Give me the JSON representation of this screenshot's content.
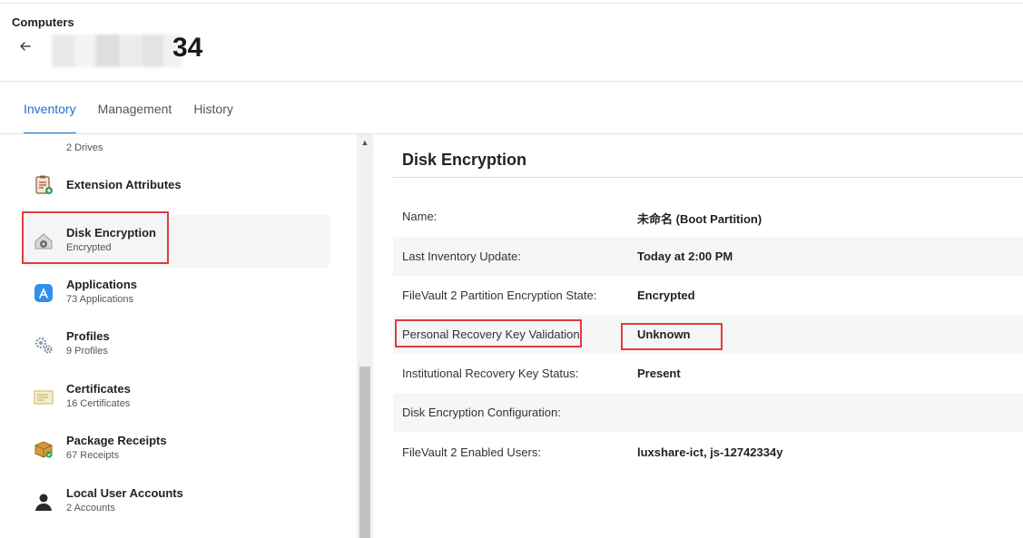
{
  "header": {
    "breadcrumb": "Computers",
    "title_visible_suffix": "34"
  },
  "tabs": [
    {
      "label": "Inventory",
      "active": true
    },
    {
      "label": "Management",
      "active": false
    },
    {
      "label": "History",
      "active": false
    }
  ],
  "sidebar": {
    "items": [
      {
        "label": "",
        "sub": "2 Drives",
        "icon": "disk-drive-icon"
      },
      {
        "label": "Extension Attributes",
        "sub": "",
        "icon": "clipboard-icon"
      },
      {
        "label": "Disk Encryption",
        "sub": "Encrypted",
        "icon": "lock-disk-icon",
        "selected": true
      },
      {
        "label": "Applications",
        "sub": "73 Applications",
        "icon": "app-store-icon"
      },
      {
        "label": "Profiles",
        "sub": "9 Profiles",
        "icon": "gears-icon"
      },
      {
        "label": "Certificates",
        "sub": "16 Certificates",
        "icon": "certificate-icon"
      },
      {
        "label": "Package Receipts",
        "sub": "67 Receipts",
        "icon": "package-icon"
      },
      {
        "label": "Local User Accounts",
        "sub": "2 Accounts",
        "icon": "user-icon"
      }
    ]
  },
  "detail": {
    "title": "Disk Encryption",
    "rows": [
      {
        "key": "Name:",
        "value": "未命名 (Boot Partition)"
      },
      {
        "key": "Last Inventory Update:",
        "value": "Today at 2:00 PM"
      },
      {
        "key": "FileVault 2 Partition Encryption State:",
        "value": "Encrypted"
      },
      {
        "key": "Personal Recovery Key Validation:",
        "value": "Unknown"
      },
      {
        "key": "Institutional Recovery Key Status:",
        "value": "Present"
      },
      {
        "key": "Disk Encryption Configuration:",
        "value": ""
      },
      {
        "key": "FileVault 2 Enabled Users:",
        "value": "luxshare-ict, js-12742334y"
      }
    ]
  },
  "colors": {
    "accent": "#1a6fd1",
    "highlight": "#e23b3b"
  }
}
